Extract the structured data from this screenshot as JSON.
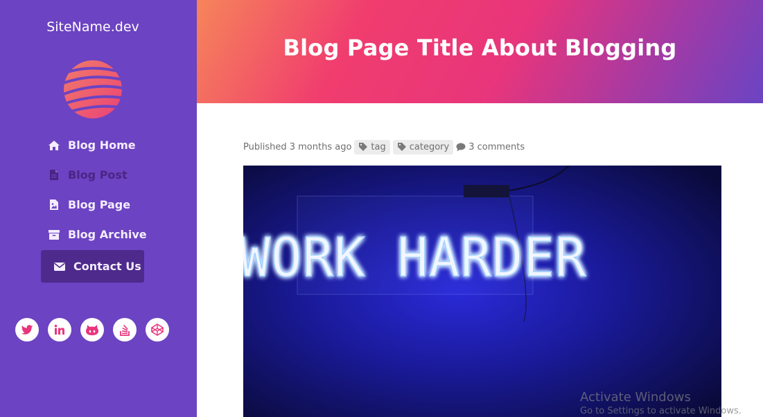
{
  "sidebar": {
    "site_name": "SiteName.dev",
    "nav": [
      {
        "label": "Blog Home",
        "icon": "home-icon"
      },
      {
        "label": "Blog Post",
        "icon": "document-icon"
      },
      {
        "label": "Blog Page",
        "icon": "image-file-icon"
      },
      {
        "label": "Blog Archive",
        "icon": "archive-icon"
      },
      {
        "label": "Contact Us",
        "icon": "envelope-icon"
      }
    ],
    "socials": [
      "twitter-icon",
      "linkedin-icon",
      "github-icon",
      "stackoverflow-icon",
      "codepen-icon"
    ]
  },
  "header": {
    "title": "Blog Page Title About Blogging"
  },
  "meta": {
    "published": "Published 3 months ago",
    "tag": "tag",
    "category": "category",
    "comments": "3 comments"
  },
  "hero": {
    "sign_text": "WORK HARDER"
  },
  "watermark": {
    "line1": "Activate Windows",
    "line2": "Go to Settings to activate Windows."
  },
  "colors": {
    "sidebar": "#6c43c2",
    "active_nav": "#4e2a8d",
    "accent": "#e8357b"
  }
}
